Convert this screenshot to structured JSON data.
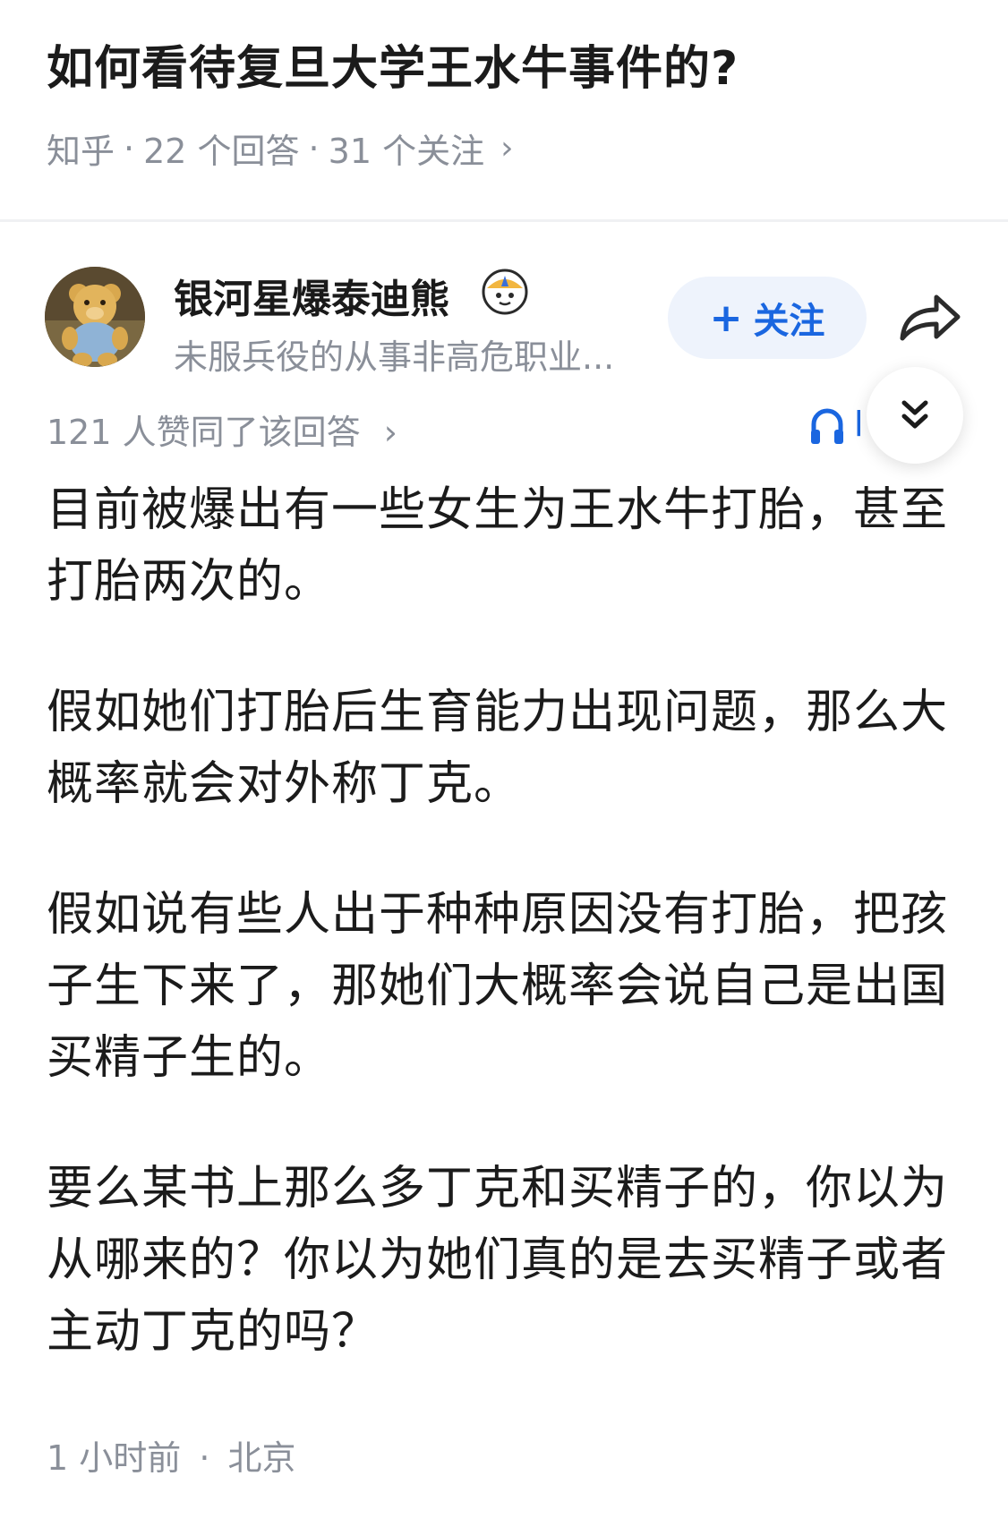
{
  "question": {
    "title": "如何看待复旦大学王水牛事件的?",
    "meta": {
      "platform": "知乎",
      "answers": "22 个回答",
      "follows": "31 个关注",
      "separator": "·"
    }
  },
  "author": {
    "name": "银河星爆泰迪熊",
    "bio": "未服兵役的从事非高危职业...",
    "follow_label": "关注",
    "avatar_icon": "teddy-bear-avatar",
    "badge_icon": "cartoon-badge-icon"
  },
  "answer": {
    "vote_summary": "121 人赞同了该回答",
    "listen_label": "l",
    "paragraphs": [
      "目前被爆出有一些女生为王水牛打胎，甚至打胎两次的。",
      "假如她们打胎后生育能力出现问题，那么大概率就会对外称丁克。",
      "假如说有些人出于种种原因没有打胎，把孩子生下来了，那她们大概率会说自己是出国买精子生的。",
      "要么某书上那么多丁克和买精子的，你以为从哪来的？你以为她们真的是去买精子或者主动丁克的吗？"
    ],
    "time": "1 小时前",
    "location": "北京",
    "separator": "·"
  },
  "colors": {
    "accent": "#1a66e0",
    "muted": "#8a8f99",
    "text": "#1b1b1b",
    "follow_bg": "#eef3fc"
  }
}
